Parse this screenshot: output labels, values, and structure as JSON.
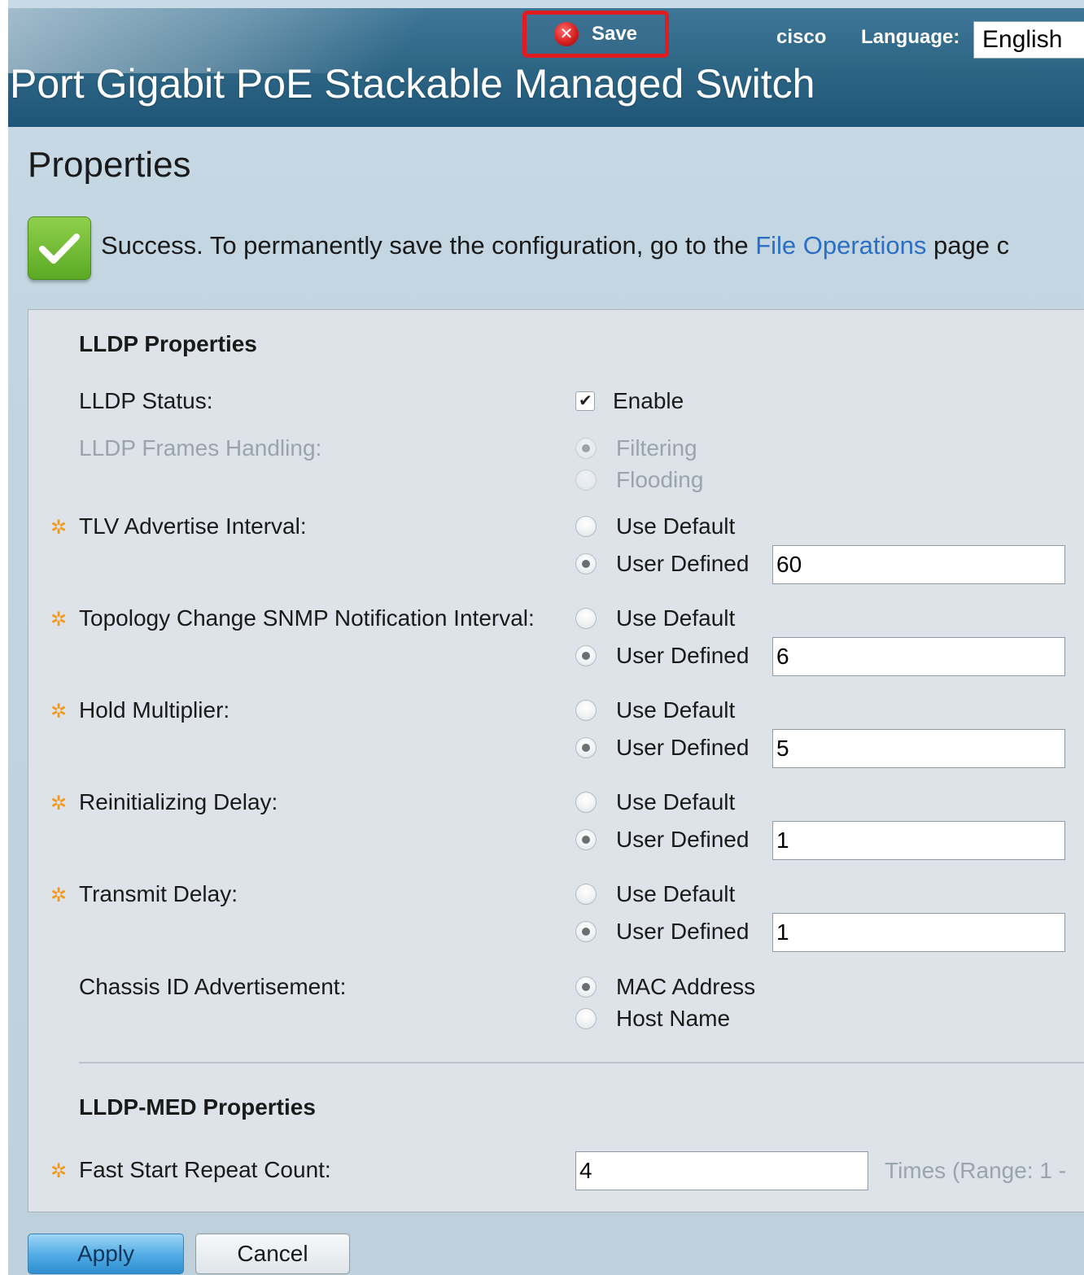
{
  "header": {
    "save_label": "Save",
    "brand": "cisco",
    "language_label": "Language:",
    "language_value": "English",
    "product_title": "Port Gigabit PoE Stackable Managed Switch"
  },
  "page": {
    "title": "Properties"
  },
  "success": {
    "text_before": "Success. To permanently save the configuration, go to the ",
    "link": "File Operations",
    "text_after": " page c"
  },
  "lldp": {
    "section_title": "LLDP Properties",
    "status": {
      "label": "LLDP Status:",
      "option": "Enable",
      "checked": true
    },
    "frames_handling": {
      "label": "LLDP Frames Handling:",
      "options": [
        "Filtering",
        "Flooding"
      ],
      "selected": "Filtering",
      "disabled": true
    },
    "tlv_interval": {
      "label": "TLV Advertise Interval:",
      "option_default": "Use Default",
      "option_user": "User Defined",
      "value": "60"
    },
    "topology_interval": {
      "label": "Topology Change SNMP Notification Interval:",
      "option_default": "Use Default",
      "option_user": "User Defined",
      "value": "6"
    },
    "hold_multiplier": {
      "label": "Hold Multiplier:",
      "option_default": "Use Default",
      "option_user": "User Defined",
      "value": "5"
    },
    "reinit_delay": {
      "label": "Reinitializing Delay:",
      "option_default": "Use Default",
      "option_user": "User Defined",
      "value": "1"
    },
    "transmit_delay": {
      "label": "Transmit Delay:",
      "option_default": "Use Default",
      "option_user": "User Defined",
      "value": "1"
    },
    "chassis_id": {
      "label": "Chassis ID Advertisement:",
      "options": [
        "MAC Address",
        "Host Name"
      ],
      "selected": "MAC Address"
    }
  },
  "lldp_med": {
    "section_title": "LLDP-MED Properties",
    "fast_start": {
      "label": "Fast Start Repeat Count:",
      "value": "4",
      "hint": "Times (Range: 1 -"
    }
  },
  "buttons": {
    "apply": "Apply",
    "cancel": "Cancel"
  },
  "colors": {
    "header_blue": "#2f6787",
    "save_highlight": "#e01b22",
    "success_green": "#5aa924",
    "link_blue": "#2a6fc4",
    "required_gear": "#f39a1e"
  }
}
